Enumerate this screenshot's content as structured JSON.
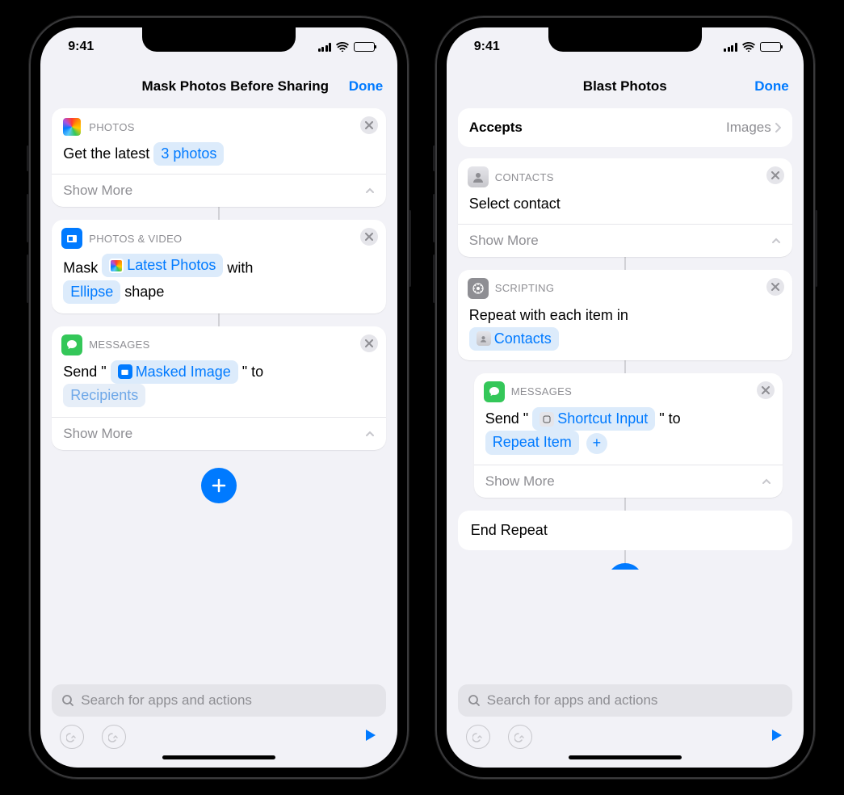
{
  "status": {
    "time": "9:41"
  },
  "left": {
    "title": "Mask Photos Before Sharing",
    "titleClass": "off",
    "done": "Done",
    "showMore": "Show More",
    "card1": {
      "category": "PHOTOS",
      "pre": "Get the latest ",
      "token": "3 photos"
    },
    "card2": {
      "category": "PHOTOS & VIDEO",
      "t1": "Mask ",
      "token1": "Latest Photos",
      "t2": " with ",
      "token2": "Ellipse",
      "t3": " shape"
    },
    "card3": {
      "category": "MESSAGES",
      "t1": "Send \" ",
      "token1": "Masked Image",
      "t2": " \" to ",
      "token2": "Recipients"
    },
    "searchPlaceholder": "Search for apps and actions"
  },
  "right": {
    "title": "Blast Photos",
    "done": "Done",
    "showMore": "Show More",
    "accepts": {
      "label": "Accepts",
      "value": "Images"
    },
    "card1": {
      "category": "CONTACTS",
      "line": "Select contact"
    },
    "card2": {
      "category": "SCRIPTING",
      "t1": "Repeat with each item in ",
      "token1": "Contacts"
    },
    "card3": {
      "category": "MESSAGES",
      "t1": "Send \" ",
      "token1": "Shortcut Input",
      "t2": " \" to ",
      "token2": "Repeat Item"
    },
    "endRepeat": "End Repeat",
    "searchPlaceholder": "Search for apps and actions"
  }
}
